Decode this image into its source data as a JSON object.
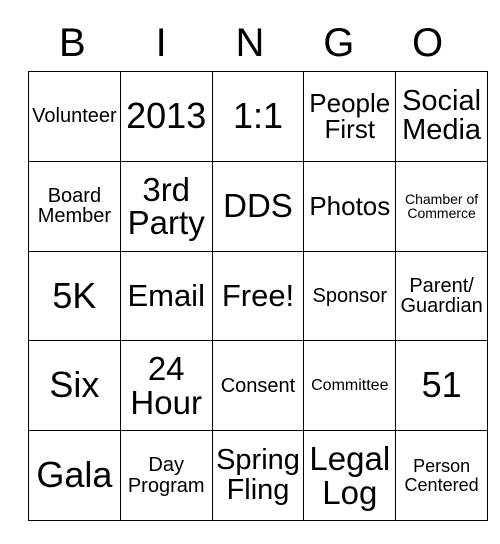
{
  "card": {
    "type": "bingo-card",
    "columns": 5,
    "rows": 5,
    "background_color": "#ffffff",
    "text_color": "#000000",
    "border_color": "#000000",
    "header": {
      "letters": [
        "B",
        "I",
        "N",
        "G",
        "O"
      ]
    },
    "cells": [
      [
        {
          "text": "Volunteer",
          "size": "fs-20"
        },
        {
          "text": "2013",
          "size": "fs-36"
        },
        {
          "text": "1:1",
          "size": "fs-36"
        },
        {
          "text": "People First",
          "size": "fs-26"
        },
        {
          "text": "Social Media",
          "size": "fs-29"
        }
      ],
      [
        {
          "text": "Board Member",
          "size": "fs-20"
        },
        {
          "text": "3rd Party",
          "size": "fs-33"
        },
        {
          "text": "DDS",
          "size": "fs-33"
        },
        {
          "text": "Photos",
          "size": "fs-26"
        },
        {
          "text": "Chamber of Commerce",
          "size": "fs-14"
        }
      ],
      [
        {
          "text": "5K",
          "size": "fs-36"
        },
        {
          "text": "Email",
          "size": "fs-31"
        },
        {
          "text": "Free!",
          "size": "fs-31"
        },
        {
          "text": "Sponsor",
          "size": "fs-20"
        },
        {
          "text": "Parent/ Guardian",
          "size": "fs-20"
        }
      ],
      [
        {
          "text": "Six",
          "size": "fs-36"
        },
        {
          "text": "24 Hour",
          "size": "fs-33"
        },
        {
          "text": "Consent",
          "size": "fs-20"
        },
        {
          "text": "Committee",
          "size": "fs-16"
        },
        {
          "text": "51",
          "size": "fs-36"
        }
      ],
      [
        {
          "text": "Gala",
          "size": "fs-36"
        },
        {
          "text": "Day Program",
          "size": "fs-20"
        },
        {
          "text": "Spring Fling",
          "size": "fs-29"
        },
        {
          "text": "Legal Log",
          "size": "fs-33"
        },
        {
          "text": "Person Centered",
          "size": "fs-18"
        }
      ]
    ]
  }
}
